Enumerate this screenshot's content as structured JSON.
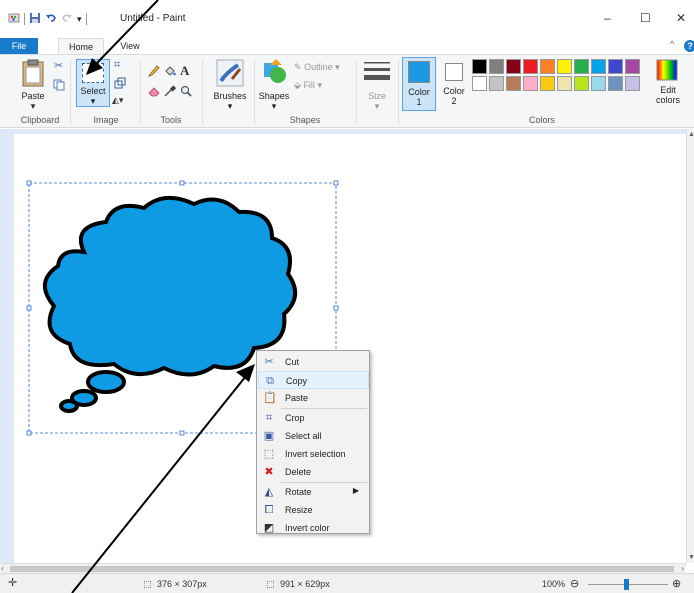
{
  "window": {
    "title": "Untitled - Paint",
    "minimize": "–",
    "maximize": "☐",
    "close": "✕"
  },
  "tabs": {
    "file": "File",
    "home": "Home",
    "view": "View",
    "collapse": "^",
    "help": "?"
  },
  "ribbon": {
    "clipboard": {
      "paste": "Paste",
      "group": "Clipboard"
    },
    "image": {
      "select": "Select",
      "group": "Image"
    },
    "tools": {
      "group": "Tools",
      "text_tool": "A"
    },
    "brushes": {
      "label": "Brushes"
    },
    "shapes": {
      "shapes": "Shapes",
      "outline": "Outline",
      "fill": "Fill",
      "group": "Shapes"
    },
    "size": {
      "label": "Size"
    },
    "colors": {
      "color1": "Color 1",
      "color1_line1": "Color",
      "color1_line2": "1",
      "color2_line1": "Color",
      "color2_line2": "2",
      "edit_line1": "Edit",
      "edit_line2": "colors",
      "group": "Colors",
      "color1_value": "#1a9ae6",
      "color2_value": "#ffffff",
      "palette_row1": [
        "#000000",
        "#7f7f7f",
        "#880015",
        "#ed1c24",
        "#ff7f27",
        "#fff200",
        "#22b14c",
        "#00a2e8",
        "#3f48cc",
        "#a349a4"
      ],
      "palette_row2": [
        "#ffffff",
        "#c3c3c3",
        "#b97a57",
        "#ffaec9",
        "#ffc90e",
        "#efe4b0",
        "#b5e61d",
        "#99d9ea",
        "#7092be",
        "#c8bfe7"
      ]
    }
  },
  "context_menu": {
    "items": [
      {
        "label": "Cut",
        "icon": "scissors-icon",
        "glyph": "✂"
      },
      {
        "label": "Copy",
        "icon": "copy-icon",
        "glyph": "⧉"
      },
      {
        "label": "Paste",
        "icon": "paste-icon",
        "glyph": "📋"
      },
      {
        "label": "Crop",
        "icon": "crop-icon",
        "glyph": "⌗"
      },
      {
        "label": "Select all",
        "icon": "select-all-icon",
        "glyph": "▣"
      },
      {
        "label": "Invert selection",
        "icon": "invert-selection-icon",
        "glyph": "⬚"
      },
      {
        "label": "Delete",
        "icon": "delete-icon",
        "glyph": "✖"
      },
      {
        "label": "Rotate",
        "icon": "rotate-icon",
        "glyph": "◭"
      },
      {
        "label": "Resize",
        "icon": "resize-icon",
        "glyph": "⧠"
      },
      {
        "label": "Invert color",
        "icon": "invert-color-icon",
        "glyph": "◩"
      }
    ],
    "highlighted": "Copy"
  },
  "status": {
    "selection_size": "376 × 307px",
    "image_size": "991 × 629px",
    "zoom": "100%",
    "zoom_out": "⊖",
    "zoom_in": "⊕"
  },
  "canvas": {
    "shape_fill": "#0f9be3",
    "shape_outline": "#000000"
  }
}
